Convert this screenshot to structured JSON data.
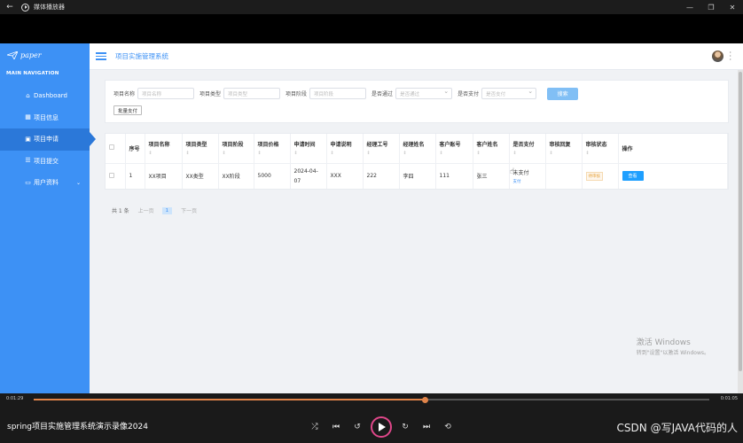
{
  "window": {
    "title": "媒体播放器"
  },
  "app": {
    "logo": "paper",
    "nav_section": "MAIN NAVIGATION",
    "menu": [
      {
        "label": "Dashboard",
        "icon": "home-icon"
      },
      {
        "label": "项目信息",
        "icon": "grid-icon"
      },
      {
        "label": "项目申请",
        "icon": "lock-icon",
        "active": true
      },
      {
        "label": "项目提交",
        "icon": "list-icon"
      },
      {
        "label": "用户资料",
        "icon": "card-icon"
      }
    ],
    "header": {
      "title": "项目实施管理系统"
    },
    "search": {
      "name_label": "项目名称",
      "name_placeholder": "项目名称",
      "type_label": "项目类型",
      "type_placeholder": "项目类型",
      "stage_label": "项目阶段",
      "stage_placeholder": "项目阶段",
      "pass_label": "是否通过",
      "pass_placeholder": "是否通过",
      "paid_label": "是否支付",
      "paid_placeholder": "是否支付",
      "search_button": "搜索",
      "batch_button": "批量支付"
    },
    "table": {
      "headers": [
        "序号",
        "项目名称",
        "项目类型",
        "项目阶段",
        "项目价格",
        "申请时间",
        "申请说明",
        "经理工号",
        "经理姓名",
        "客户账号",
        "客户姓名",
        "是否支付",
        "审核回复",
        "审核状态",
        "操作"
      ],
      "sort_hint": "⇕",
      "rows": [
        {
          "index": "1",
          "name": "XX项目",
          "type": "XX类型",
          "stage": "XX阶段",
          "price": "5000",
          "date": "2024-04-07",
          "desc": "XXX",
          "manager_id": "222",
          "manager_name": "李四",
          "client_acc": "111",
          "client_name": "张三",
          "paid": "未支付",
          "pay_link": "支付",
          "reply": "",
          "status": "待审核",
          "action": "查看"
        }
      ]
    },
    "pager": {
      "total": "共 1 条",
      "prev": "上一页",
      "current": "1",
      "next": "下一页"
    },
    "watermark": {
      "line1": "激活 Windows",
      "line2": "转到\"设置\"以激活 Windows。"
    }
  },
  "player": {
    "time_elapsed": "0:01:29",
    "time_remaining": "0:01:05",
    "progress": 0.58,
    "title": "spring项目实施管理系统演示录像2024",
    "watermark": "CSDN @写JAVA代码的人"
  },
  "colors": {
    "sidebar": "#3d91f5",
    "accent": "#e0844a",
    "play_ring": "#e0478a"
  }
}
